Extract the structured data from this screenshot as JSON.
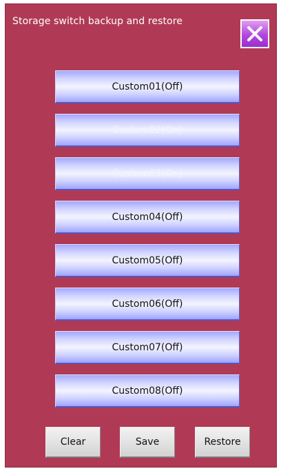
{
  "window": {
    "title": "Storage switch backup and restore"
  },
  "buttons": [
    {
      "label": "Custom01(Off)",
      "state": "off"
    },
    {
      "label": "Custom02(On)",
      "state": "on"
    },
    {
      "label": "Custom03(On)",
      "state": "on"
    },
    {
      "label": "Custom04(Off)",
      "state": "off"
    },
    {
      "label": "Custom05(Off)",
      "state": "off"
    },
    {
      "label": "Custom06(Off)",
      "state": "off"
    },
    {
      "label": "Custom07(Off)",
      "state": "off"
    },
    {
      "label": "Custom08(Off)",
      "state": "off"
    }
  ],
  "actions": {
    "clear_label": "Clear",
    "save_label": "Save",
    "restore_label": "Restore"
  },
  "icons": {
    "close": "close-icon"
  },
  "colors": {
    "panel_background": "#b03a55",
    "custom_button": "#cfd2ff",
    "custom_button_on_text": "#f2f4ff",
    "close_button": "#b247dc",
    "action_button": "#e3e3e3"
  }
}
